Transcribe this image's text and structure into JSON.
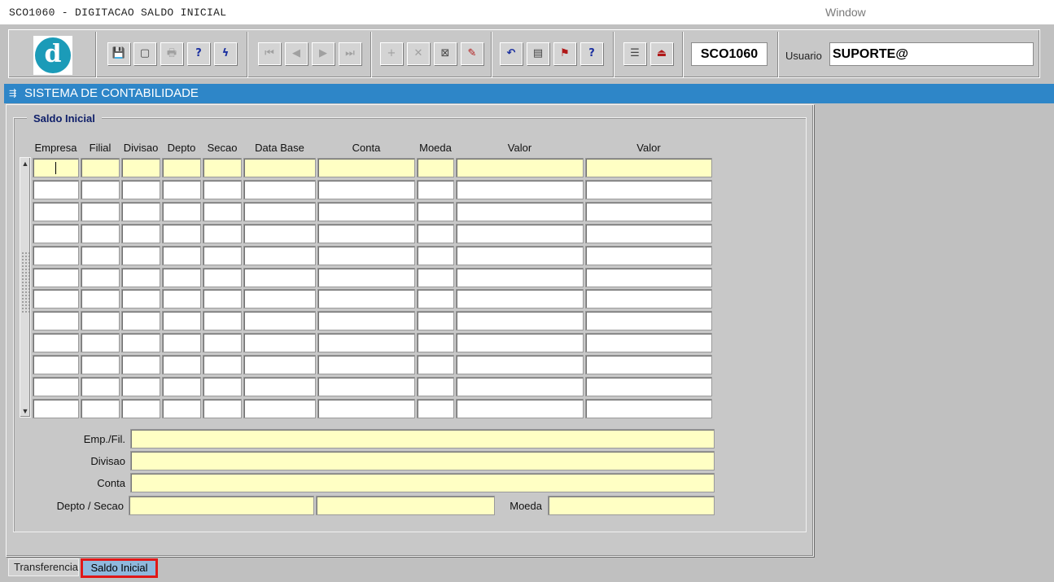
{
  "window": {
    "title": "SCO1060 - DIGITACAO SALDO INICIAL",
    "menu_window": "Window"
  },
  "toolbar": {
    "logo_letter": "d",
    "buttons": [
      {
        "name": "save-icon",
        "glyph": "💾"
      },
      {
        "name": "print-preview-icon",
        "glyph": "▢"
      },
      {
        "name": "print-icon",
        "glyph": "🖶"
      },
      {
        "name": "query-icon",
        "glyph": "?"
      },
      {
        "name": "execute-query-icon",
        "glyph": "ϟ"
      },
      {
        "name": "first-record-icon",
        "glyph": "⏮"
      },
      {
        "name": "previous-record-icon",
        "glyph": "◀"
      },
      {
        "name": "next-record-icon",
        "glyph": "▶"
      },
      {
        "name": "last-record-icon",
        "glyph": "⏭"
      },
      {
        "name": "insert-record-icon",
        "glyph": "+"
      },
      {
        "name": "delete-record-icon",
        "glyph": "✕"
      },
      {
        "name": "clear-record-icon",
        "glyph": "⊠"
      },
      {
        "name": "edit-icon",
        "glyph": "✎"
      },
      {
        "name": "undo-icon",
        "glyph": "↶"
      },
      {
        "name": "list-values-icon",
        "glyph": "▤"
      },
      {
        "name": "flag-icon",
        "glyph": "⚑"
      },
      {
        "name": "help-icon",
        "glyph": "?"
      },
      {
        "name": "menu-icon",
        "glyph": "☰"
      },
      {
        "name": "exit-icon",
        "glyph": "⏏"
      }
    ],
    "form_code": "SCO1060",
    "user_label": "Usuario",
    "user_value": "SUPORTE@"
  },
  "app_bar": {
    "title": "SISTEMA DE CONTABILIDADE",
    "icon": "app-icon"
  },
  "section": {
    "title": "Saldo Inicial",
    "columns": [
      "Empresa",
      "Filial",
      "Divisao",
      "Depto",
      "Secao",
      "Data Base",
      "Conta",
      "Moeda",
      "Valor",
      "Valor"
    ],
    "row_count": 12
  },
  "detail": {
    "emp_fil_label": "Emp./Fil.",
    "emp_fil_value": "",
    "divisao_label": "Divisao",
    "divisao_value": "",
    "conta_label": "Conta",
    "conta_value": "",
    "depto_secao_label": "Depto / Secao",
    "depto_value": "",
    "secao_value": "",
    "moeda_label": "Moeda",
    "moeda_value": ""
  },
  "tabs": [
    {
      "label": "Transferencia",
      "active": false
    },
    {
      "label": "Saldo Inicial",
      "active": true
    }
  ]
}
